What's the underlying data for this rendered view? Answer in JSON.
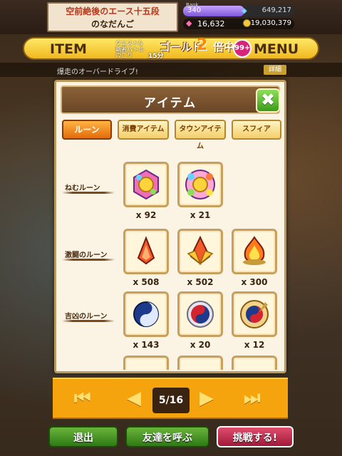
{
  "player": {
    "name_line1": "空前絶後のエース十五段",
    "name_line2": "のなだんご"
  },
  "stats": {
    "rank_label": "Rank",
    "rank": "340",
    "exp": "649,217",
    "gems": "16,632",
    "coins": "19,030,379",
    "colors": {
      "gem": "#ff6fb0",
      "coin": "#f2c742",
      "rank_bar": "#7d57d9"
    }
  },
  "nav": {
    "item": "ITEM",
    "menu": "MENU",
    "quest": "クエスト&",
    "battle": "覇者バトル",
    "gold": "ゴールド",
    "multiplier": "2",
    "gold_suffix": "倍中",
    "remain_label": "のこり",
    "remain_value": "15分",
    "badge": "99+"
  },
  "notice": {
    "text": "爆走のオーバードライブ!",
    "button": "詳細"
  },
  "dialog": {
    "title": "アイテム",
    "close_icon": "close-x-icon",
    "tabs": [
      "ルーン",
      "消費アイテム",
      "タウンアイテム",
      "スフィア"
    ],
    "active_tab": 0,
    "rows": [
      {
        "label": "ねむルーン",
        "items": [
          {
            "icon": "sleep-rune-small-icon",
            "count": "x 92"
          },
          {
            "icon": "sleep-rune-large-icon",
            "count": "x 21"
          }
        ]
      },
      {
        "label": "激闘のルーン",
        "items": [
          {
            "icon": "battle-rune-small-icon",
            "count": "x 508"
          },
          {
            "icon": "battle-rune-medium-icon",
            "count": "x 502"
          },
          {
            "icon": "battle-rune-large-icon",
            "count": "x 300"
          }
        ]
      },
      {
        "label": "吉凶のルーン",
        "items": [
          {
            "icon": "fortune-rune-small-icon",
            "count": "x 143"
          },
          {
            "icon": "fortune-rune-medium-icon",
            "count": "x 20"
          },
          {
            "icon": "fortune-rune-large-icon",
            "count": "x 12"
          }
        ]
      }
    ]
  },
  "pager": {
    "page": "5/16",
    "first_icon": "first-page-icon",
    "prev_icon": "prev-page-icon",
    "next_icon": "next-page-icon",
    "last_icon": "last-page-icon"
  },
  "buttons": {
    "exit": "退出",
    "call_friend": "友達を呼ぶ",
    "challenge": "挑戦する!"
  }
}
